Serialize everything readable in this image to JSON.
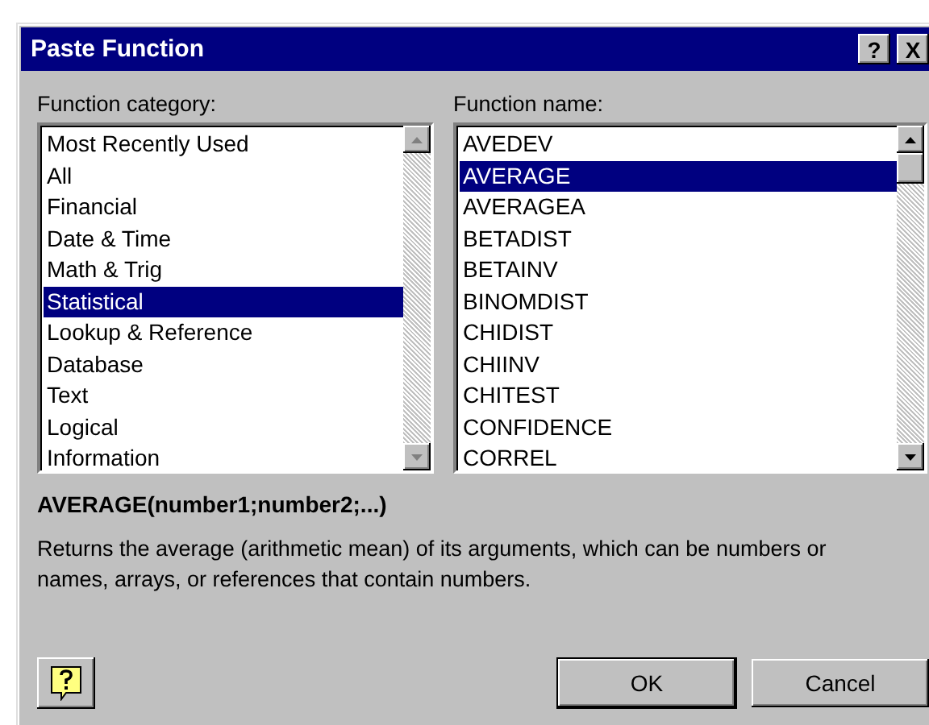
{
  "window": {
    "title": "Paste Function",
    "title_buttons": [
      "?",
      "X"
    ]
  },
  "category": {
    "label": "Function category:",
    "items": [
      {
        "label": "Most Recently Used",
        "selected": false
      },
      {
        "label": "All",
        "selected": false
      },
      {
        "label": "Financial",
        "selected": false
      },
      {
        "label": "Date & Time",
        "selected": false
      },
      {
        "label": "Math & Trig",
        "selected": false
      },
      {
        "label": "Statistical",
        "selected": true
      },
      {
        "label": "Lookup & Reference",
        "selected": false
      },
      {
        "label": "Database",
        "selected": false
      },
      {
        "label": "Text",
        "selected": false
      },
      {
        "label": "Logical",
        "selected": false
      },
      {
        "label": "Information",
        "selected": false
      }
    ]
  },
  "function": {
    "label": "Function name:",
    "items": [
      {
        "label": "AVEDEV",
        "selected": false
      },
      {
        "label": "AVERAGE",
        "selected": true
      },
      {
        "label": "AVERAGEA",
        "selected": false
      },
      {
        "label": "BETADIST",
        "selected": false
      },
      {
        "label": "BETAINV",
        "selected": false
      },
      {
        "label": "BINOMDIST",
        "selected": false
      },
      {
        "label": "CHIDIST",
        "selected": false
      },
      {
        "label": "CHIINV",
        "selected": false
      },
      {
        "label": "CHITEST",
        "selected": false
      },
      {
        "label": "CONFIDENCE",
        "selected": false
      },
      {
        "label": "CORREL",
        "selected": false
      }
    ]
  },
  "syntax": "AVERAGE(number1;number2;...)",
  "description": "Returns the average (arithmetic mean) of its arguments, which can be numbers or names, arrays, or references that contain numbers.",
  "buttons": [
    {
      "label": "OK"
    },
    {
      "label": "Cancel"
    }
  ]
}
